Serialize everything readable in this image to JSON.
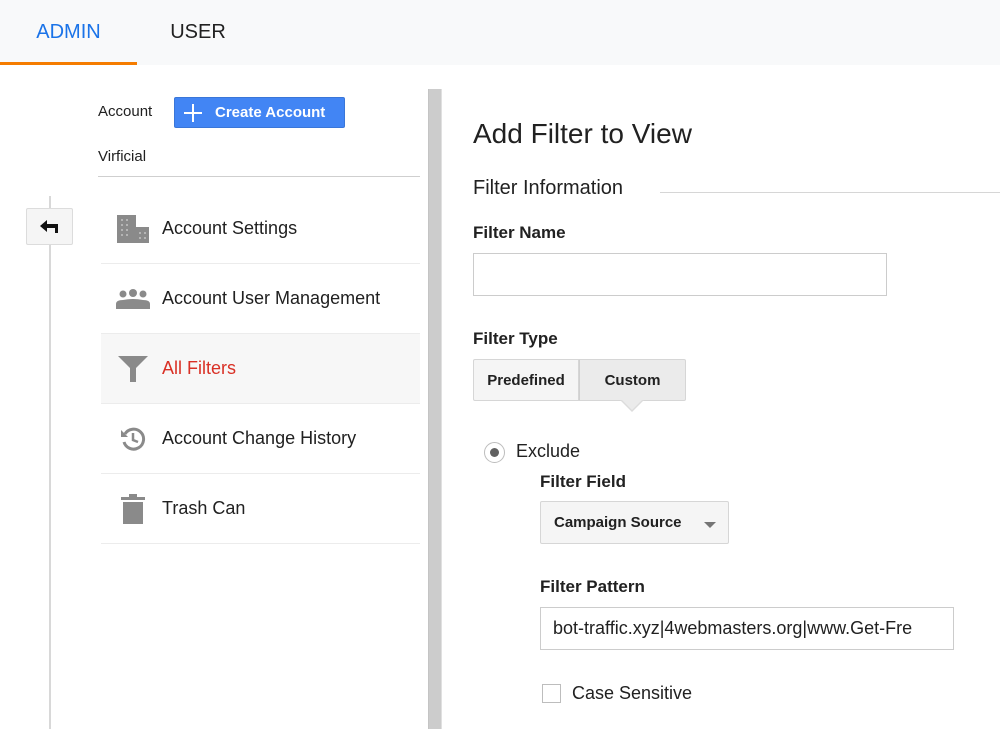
{
  "tabs": [
    {
      "label": "ADMIN",
      "active": true
    },
    {
      "label": "USER",
      "active": false
    }
  ],
  "colors": {
    "accent_blue": "#1a73e8",
    "tab_underline": "#f57c00",
    "create_button": "#4285f4",
    "active_nav": "#d93025",
    "icon_gray": "#8a8a8a"
  },
  "account": {
    "label": "Account",
    "create_button_label": "Create Account",
    "create_button_icon": "plus-icon",
    "name": "Virficial"
  },
  "back_button_icon": "back-arrow-icon",
  "nav": {
    "items": [
      {
        "label": "Account Settings",
        "icon": "building-icon",
        "active": false
      },
      {
        "label": "Account User Management",
        "icon": "people-icon",
        "active": false
      },
      {
        "label": "All Filters",
        "icon": "filter-icon",
        "active": true
      },
      {
        "label": "Account Change History",
        "icon": "history-icon",
        "active": false
      },
      {
        "label": "Trash Can",
        "icon": "trash-icon",
        "active": false
      }
    ]
  },
  "form": {
    "title": "Add Filter to View",
    "section_title": "Filter Information",
    "filter_name": {
      "label": "Filter Name",
      "value": "",
      "placeholder": ""
    },
    "filter_type": {
      "label": "Filter Type",
      "options": [
        "Predefined",
        "Custom"
      ],
      "selected": "Custom"
    },
    "mode": {
      "label": "Exclude",
      "selected": true
    },
    "filter_field": {
      "label": "Filter Field",
      "selected": "Campaign Source"
    },
    "filter_pattern": {
      "label": "Filter Pattern",
      "value": "bot-traffic.xyz|4webmasters.org|www.Get-Fre"
    },
    "case_sensitive": {
      "label": "Case Sensitive",
      "checked": false
    }
  }
}
